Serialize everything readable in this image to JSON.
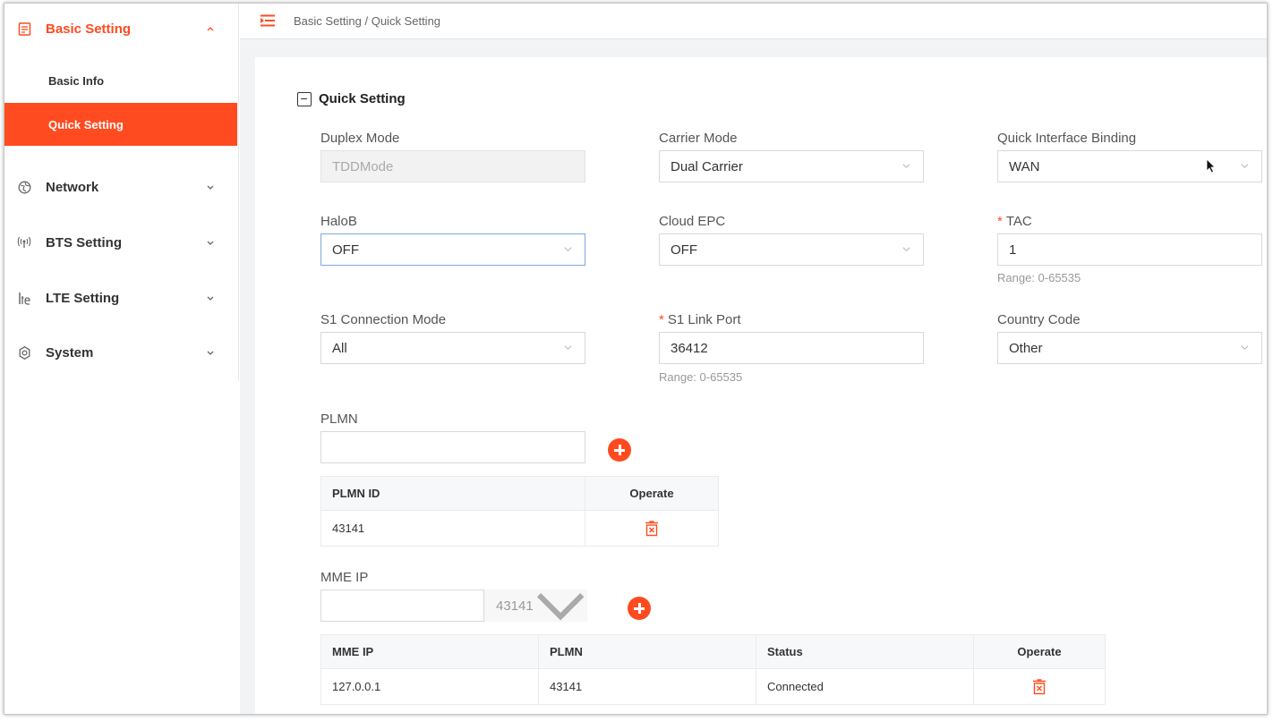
{
  "sidebar": {
    "groups": [
      {
        "label": "Basic Setting",
        "icon": "document-icon"
      },
      {
        "label": "Network",
        "icon": "network-icon"
      },
      {
        "label": "BTS Setting",
        "icon": "antenna-icon"
      },
      {
        "label": "LTE Setting",
        "icon": "lte-icon"
      },
      {
        "label": "System",
        "icon": "gear-icon"
      }
    ],
    "sub_items": [
      {
        "label": "Basic Info"
      },
      {
        "label": "Quick Setting"
      }
    ]
  },
  "breadcrumb": "Basic Setting / Quick Setting",
  "section_title": "Quick Setting",
  "form": {
    "duplex_mode": {
      "label": "Duplex Mode",
      "value": "TDDMode"
    },
    "carrier_mode": {
      "label": "Carrier Mode",
      "value": "Dual Carrier"
    },
    "quick_interface_binding": {
      "label": "Quick Interface Binding",
      "value": "WAN"
    },
    "halob": {
      "label": "HaloB",
      "value": "OFF"
    },
    "cloud_epc": {
      "label": "Cloud EPC",
      "value": "OFF"
    },
    "tac": {
      "label": "TAC",
      "value": "1",
      "hint": "Range: 0-65535",
      "required_mark": "*"
    },
    "s1_connection_mode": {
      "label": "S1 Connection Mode",
      "value": "All"
    },
    "s1_link_port": {
      "label": "S1 Link Port",
      "value": "36412",
      "hint": "Range: 0-65535",
      "required_mark": "*"
    },
    "country_code": {
      "label": "Country Code",
      "value": "Other"
    },
    "plmn": {
      "label": "PLMN",
      "value": ""
    },
    "mme_ip": {
      "label": "MME IP",
      "value": "",
      "plmn_select": "43141"
    }
  },
  "plmn_table": {
    "headers": [
      "PLMN ID",
      "Operate"
    ],
    "rows": [
      [
        "43141"
      ]
    ]
  },
  "mme_table": {
    "headers": [
      "MME IP",
      "PLMN",
      "Status",
      "Operate"
    ],
    "rows": [
      [
        "127.0.0.1",
        "43141",
        "Connected"
      ]
    ]
  },
  "colors": {
    "accent": "#ff4b1f"
  }
}
